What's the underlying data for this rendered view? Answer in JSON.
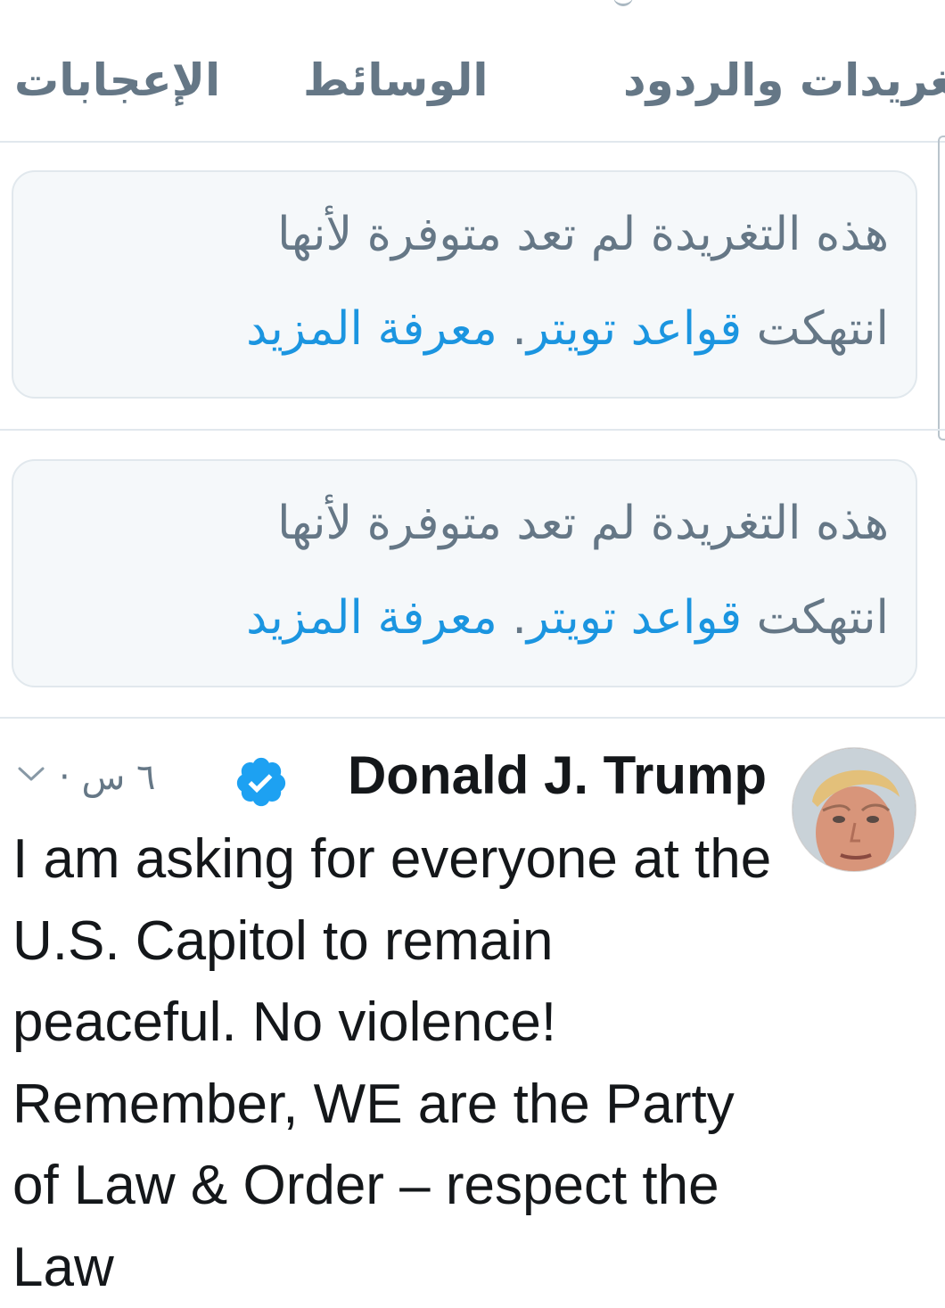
{
  "tabs": {
    "tweets_replies": "تغريدات والردود",
    "media": "الوسائط",
    "likes": "الإعجابات"
  },
  "withheld_notice": {
    "line1": "هذه التغريدة لم تعد متوفرة لأنها",
    "line2_prefix": "انتهكت ",
    "rules_link": "قواعد تويتر",
    "period": ".",
    "learn_more": " معرفة المزيد"
  },
  "tweet": {
    "display_name": "Donald J. Trump",
    "verified": true,
    "separator": "·",
    "time": "٦ س",
    "text": "I am asking for everyone at the U.S. Capitol to remain peaceful. No violence! Remember, WE are the Party of Law & Order – respect the Law"
  },
  "colors": {
    "link": "#1b95e0",
    "secondary_text": "#657786",
    "primary_text": "#14171a",
    "notice_background": "#f5f8fa",
    "border": "#e1e8ed",
    "verified_badge": "#1da1f2"
  },
  "icons": {
    "verified": "verified-badge-icon",
    "menu": "chevron-down-icon"
  }
}
